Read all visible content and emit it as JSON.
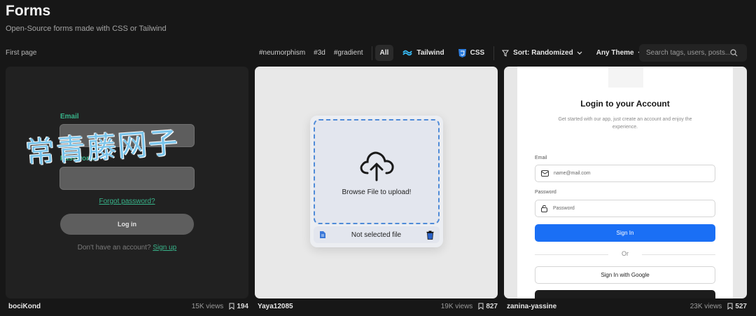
{
  "header": {
    "title": "Forms",
    "subtitle": "Open-Source forms made with CSS or Tailwind",
    "first_page": "First page"
  },
  "toolbar": {
    "tags": [
      "#neumorphism",
      "#3d",
      "#gradient"
    ],
    "filter_all": "All",
    "filter_tailwind": "Tailwind",
    "filter_css": "CSS",
    "sort_label": "Sort: Randomized",
    "theme_label": "Any Theme",
    "search_placeholder": "Search tags, users, posts..."
  },
  "cards": [
    {
      "author": "bociKond",
      "views": "15K views",
      "saves": "194",
      "email_label": "Email",
      "password_label": "Password",
      "forgot": "Forgot password?",
      "login": "Log in",
      "no_account": "Don't have an account?",
      "signup": "Sign up",
      "watermark": "常青藤网子"
    },
    {
      "author": "Yaya12085",
      "views": "19K views",
      "saves": "827",
      "browse": "Browse File to upload!",
      "file_status": "Not selected file"
    },
    {
      "author": "zanina-yassine",
      "views": "23K views",
      "saves": "527",
      "title": "Login to your Account",
      "description": "Get started with our app, just create an account and enjoy the experience.",
      "email_label": "Email",
      "email_placeholder": "name@mail.com",
      "password_label": "Password",
      "password_placeholder": "Password",
      "signin": "Sign In",
      "or": "Or",
      "google": "Sign In with Google"
    }
  ],
  "colors": {
    "background": "#171717",
    "accent_green": "#38b48a",
    "primary_blue": "#1a6ff5",
    "dashed_blue": "#4f8bd8"
  }
}
